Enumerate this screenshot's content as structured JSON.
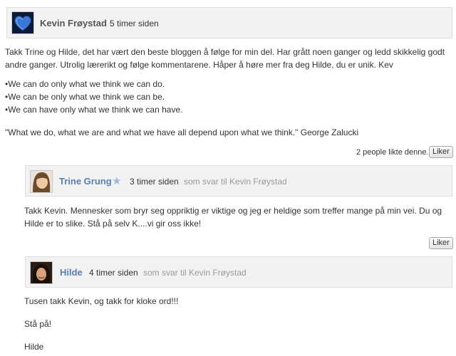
{
  "comments": [
    {
      "author": "Kevin Frøystad",
      "time": "5 timer siden",
      "paragraphs": [
        "Takk Trine og Hilde, det har vært den beste bloggen å følge for min del. Har grått noen ganger og ledd skikkelig godt andre ganger. Utrolig lærerikt og følge kommentarene. Håper å høre mer fra deg Hilde, du er unik. Kev",
        "•We can do only what we think we can do.",
        "•We can be only what we think we can be.",
        "•We can have only what we think we can have.",
        "\"What we do, what we are and what we have all depend upon what we think.\" George Zalucki"
      ],
      "like_count": "2 people likte denne.",
      "like_label": "Liker"
    },
    {
      "author": "Trine Grung",
      "time": "3 timer siden",
      "reply_to": "som svar til Kevin Frøystad",
      "paragraphs": [
        "Takk Kevin. Mennesker som bryr seg oppriktig er viktige og jeg er heldige som treffer mange på min vei. Du og Hilde er to slike. Stå på selv K....vi gir oss ikke!"
      ],
      "like_label": "Liker"
    },
    {
      "author": "Hilde",
      "time": "4 timer siden",
      "reply_to": "som svar til Kevin Frøystad",
      "paragraphs": [
        "Tusen takk Kevin, og takk for kloke ord!!!",
        "Stå på!",
        "Hilde"
      ]
    }
  ],
  "colors": {
    "author_name_main": "#555555",
    "author_name_reply": "#5a7fae",
    "star": "#9bb8e0"
  },
  "icons": {
    "star": "★"
  }
}
